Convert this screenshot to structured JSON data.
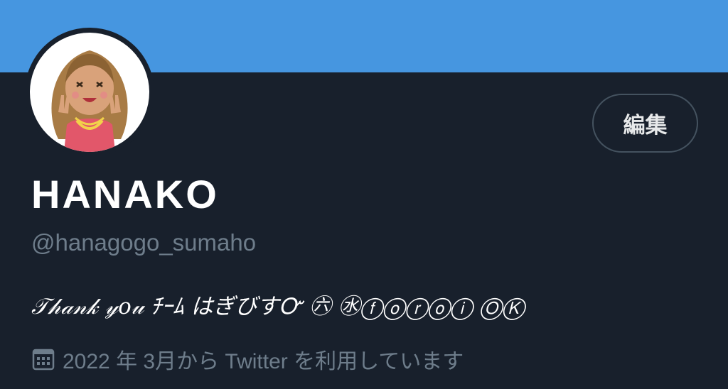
{
  "header": {
    "banner_color": "#4696e0",
    "edit_button_label": "編集"
  },
  "profile": {
    "avatar_icon": "avatar-icon",
    "display_name": "HANAKO",
    "handle": "@hanagogo_sumaho",
    "bio": "𝒯𝒽𝒶𝓃𝓀 𝓎𝑜𝓊 ﾁｰﾑ はぎびすᏅ ㊅ ㊌ⓕⓞⓡⓞⓘ ⓄⓀ",
    "joined": "2022 年 3月から Twitter を利用しています",
    "joined_icon": "calendar-icon"
  },
  "colors": {
    "background": "#18202c",
    "secondary_text": "#6e7d8b",
    "border": "#44525f"
  }
}
